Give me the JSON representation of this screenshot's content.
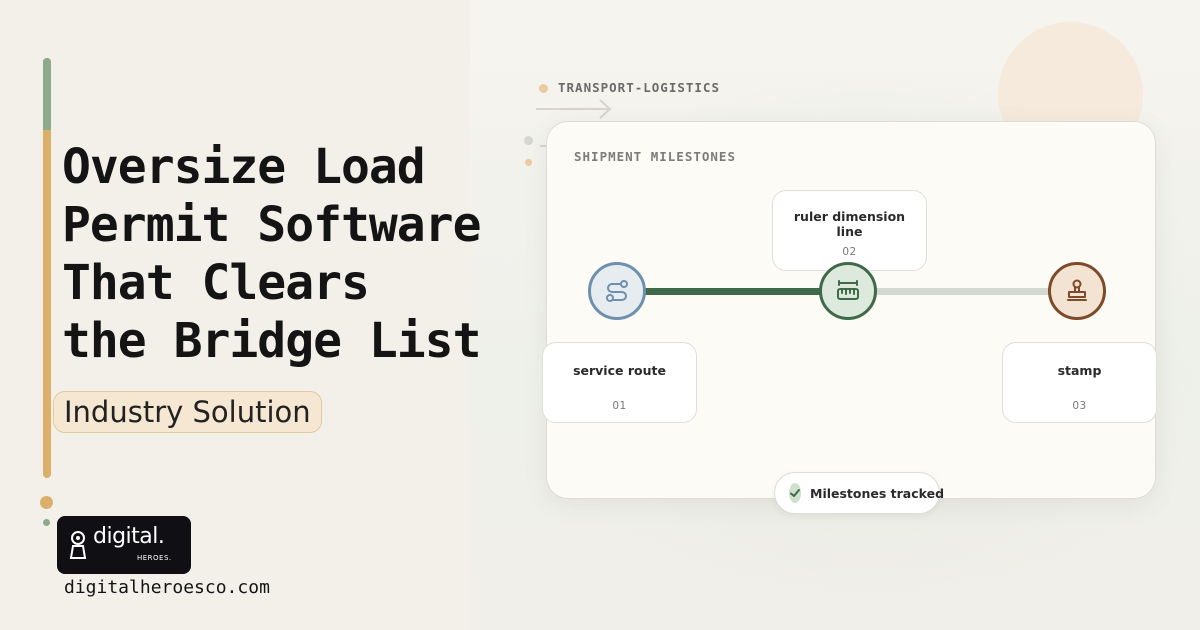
{
  "hero": {
    "headline": [
      "Oversize Load",
      "Permit Software",
      "That Clears",
      "the Bridge List"
    ],
    "pill": "Industry Solution"
  },
  "brand": {
    "logo_word": "digital.",
    "logo_sub": "HEROES.",
    "url": "digitalheroesco.com"
  },
  "panel": {
    "industry": "TRANSPORT-LOGISTICS",
    "title": "SHIPMENT MILESTONES",
    "milestones": [
      {
        "label": "service route",
        "number": "01",
        "icon": "route-icon",
        "color": "#6e8fae"
      },
      {
        "label": "ruler dimension line",
        "number": "02",
        "icon": "ruler-icon",
        "color": "#3f6a49"
      },
      {
        "label": "stamp",
        "number": "03",
        "icon": "stamp-icon",
        "color": "#7d4a2a"
      }
    ],
    "progress_done": 0.5,
    "badge": "Milestones tracked"
  },
  "colors": {
    "accent_gold": "#dcb06a",
    "accent_green": "#8bab8a",
    "track_done": "#3f6a49",
    "track_todo": "#d3d8d0"
  }
}
